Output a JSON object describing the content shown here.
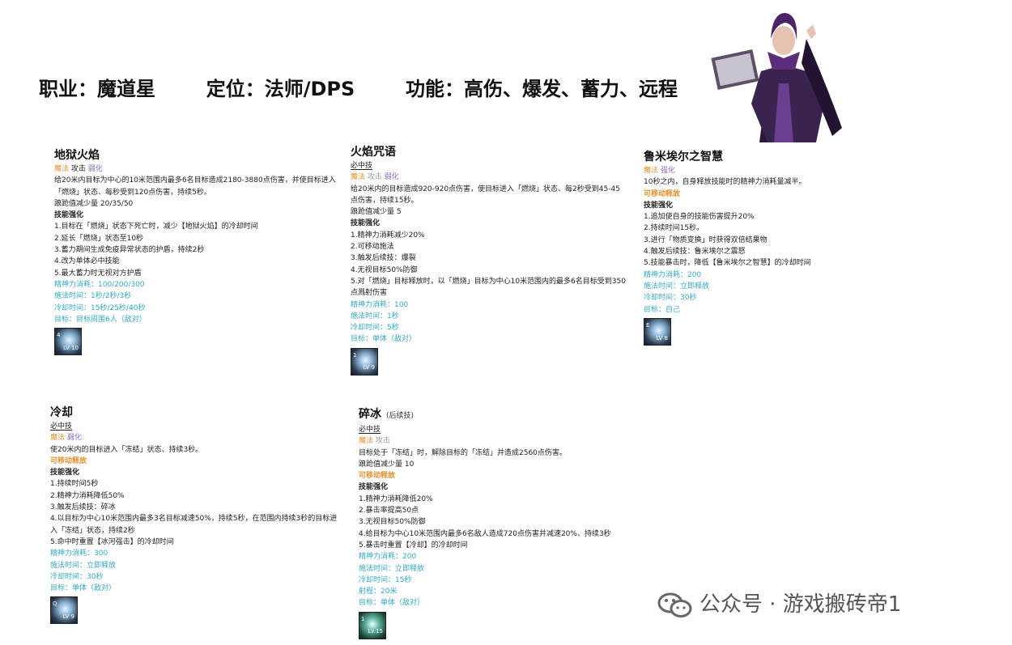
{
  "header": {
    "class_text": "职业：魔道星",
    "role_text": "定位：法师/DPS",
    "function_text": "功能：高伤、爆发、蓄力、远程"
  },
  "skills": [
    {
      "title": "地狱火焰",
      "must_hit": "",
      "tags": [
        "魔法",
        "攻击",
        "弱化"
      ],
      "desc": "给20米内目标为中心的10米范围内最多6名目标造成2180-3880点伤害，并使目标进入「燃烧」状态、每秒受到120点伤害，持续5秒。",
      "stagger": "踉跄值减少量 20/35/50",
      "movable": "",
      "enhance_label": "技能强化",
      "enhancements": [
        "1.目标在「燃烧」状态下死亡时，减少【地狱火焰】的冷却时间",
        "2.延长「燃烧」状态至10秒",
        "3.蓄力期间生成免疫异常状态的护盾，持续2秒",
        "4.改为单体必中技能",
        "5.最大蓄力时无视对方护盾"
      ],
      "stats": [
        "精神力消耗：100/200/300",
        "施法时间：1秒/2秒/3秒",
        "冷却时间：15秒/25秒/40秒",
        "目标：目标周围6人（敌对）"
      ],
      "icon": {
        "key": "4",
        "lv": "LV 10"
      }
    },
    {
      "title": "火焰咒语",
      "must_hit": "必中技",
      "tags": [
        "魔法",
        "攻击",
        "弱化"
      ],
      "desc": "给20米内的目标造成920-920点伤害，使目标进入「燃烧」状态、每2秒受到45-45点伤害，持续15秒。",
      "stagger": "踉跄值减少量 5",
      "movable": "",
      "enhance_label": "技能强化",
      "enhancements": [
        "1.精神力消耗减少20%",
        "2.可移动施法",
        "3.触发后续技：爆裂",
        "4.无视目标50%防御",
        "5.对「燃烧」目标释放时，以「燃烧」目标为中心10米范围内的最多6名目标受到350点溅射伤害"
      ],
      "stats": [
        "精神力消耗：100",
        "施法时间：1秒",
        "冷却时间：5秒",
        "目标：单体（敌对）"
      ],
      "icon": {
        "key": "1",
        "lv": "LV 9"
      }
    },
    {
      "title": "鲁米埃尔之智慧",
      "must_hit": "",
      "tags": [
        "魔法",
        "强化"
      ],
      "desc": "10秒之内，自身释放技能时的精神力消耗量减半。",
      "stagger": "",
      "movable": "可移动释放",
      "enhance_label": "技能强化",
      "enhancements": [
        "1.追加使自身的技能伤害提升20%",
        "2.持续时间15秒。",
        "3.进行「物质变换」时获得双倍结果物",
        "4.触发后续技：鲁米埃尔之震怒",
        "5.技能暴击时，降低【鲁米埃尔之智慧】的冷却时间"
      ],
      "stats": [
        "精神力消耗：200",
        "施法时间：立即释放",
        "冷却时间：30秒",
        "目标：自己"
      ],
      "icon": {
        "key": "E",
        "lv": "LV 8"
      }
    },
    {
      "title": "冷却",
      "must_hit": "必中技",
      "tags": [
        "魔法",
        "弱化"
      ],
      "desc": "使20米内的目标进入「冻结」状态、持续3秒。",
      "stagger": "",
      "movable": "可移动释放",
      "enhance_label": "技能强化",
      "enhancements": [
        "1.持续时间5秒",
        "2.精神力消耗降低50%",
        "3.触发后续技：碎冰",
        "4.以目标为中心10米范围内最多3名目标减速50%，持续5秒，在范围内持续3秒的目标进入「冻结」状态，持续2秒",
        "5.命中时重置【冰河强击】的冷却时间"
      ],
      "stats": [
        "精神力消耗：300",
        "施法时间：立即释放",
        "冷却时间：30秒",
        "目标：单体（敌对）"
      ],
      "icon": {
        "key": "Q",
        "lv": "LV 9"
      }
    },
    {
      "title": "碎冰",
      "subtitle": "(后续技)",
      "must_hit": "必中技",
      "tags": [
        "魔法",
        "攻击"
      ],
      "desc": "目标处于「冻结」时，解除目标的「冻结」并造成2560点伤害。",
      "stagger": "踉跄值减少量 10",
      "movable": "可移动释放",
      "enhance_label": "技能强化",
      "enhancements": [
        "1.精神力消耗降低20%",
        "2.暴击率提高50点",
        "3.无视目标50%防御",
        "4.给目标为中心10米范围内最多6名敌人造成720点伤害并减速20%、持续3秒",
        "5.暴击时重置【冷却】的冷却时间"
      ],
      "stats": [
        "精神力消耗：200",
        "施法时间：立即释放",
        "冷却时间：15秒",
        "射程：20米",
        "目标：单体（敌对）"
      ],
      "icon": {
        "key": "1",
        "lv": "Lv.15"
      }
    }
  ],
  "watermark": "公众号 · 游戏搬砖帝1",
  "colors": {
    "orange": "#e8902e",
    "purple": "#8a6ad0",
    "teal": "#34a8c8"
  }
}
